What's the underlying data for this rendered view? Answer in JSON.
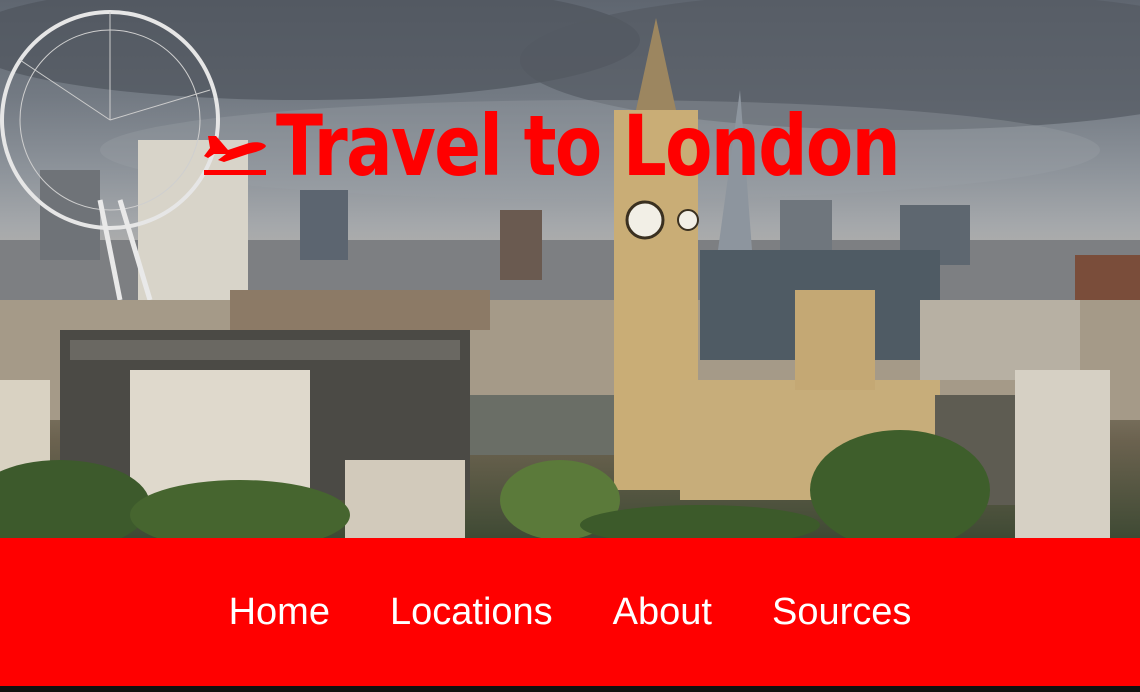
{
  "header": {
    "title": "Travel to London",
    "logo_icon": "airplane-departure-icon",
    "accent_color": "#ff0000"
  },
  "nav": {
    "items": [
      {
        "label": "Home"
      },
      {
        "label": "Locations"
      },
      {
        "label": "About"
      },
      {
        "label": "Sources"
      }
    ],
    "background_color": "#ff0000",
    "text_color": "#ffffff"
  }
}
